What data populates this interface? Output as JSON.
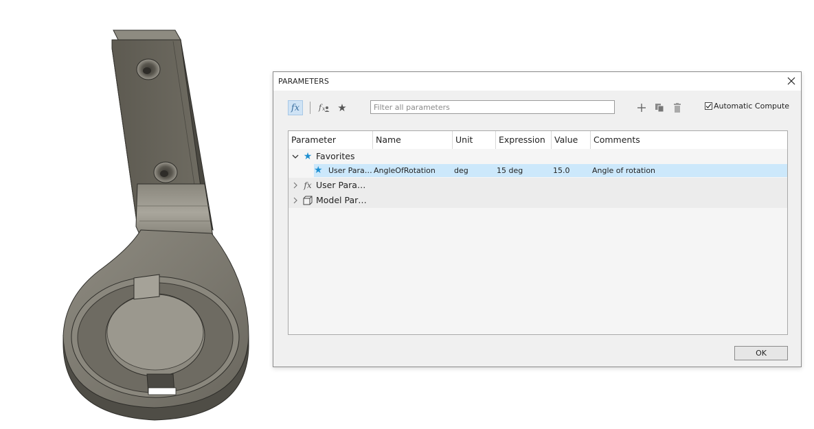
{
  "dialog": {
    "title": "PARAMETERS",
    "toolbar": {
      "filter_placeholder": "Filter all parameters",
      "auto_compute_label": "Automatic Compute",
      "auto_compute_checked": true,
      "icons": [
        "fx-icon",
        "fx-user-icon",
        "star-icon",
        "add-icon",
        "copy-icon",
        "delete-icon"
      ]
    },
    "table": {
      "columns": [
        "Parameter",
        "Name",
        "Unit",
        "Expression",
        "Value",
        "Comments"
      ],
      "groups": {
        "favorites": {
          "label": "Favorites",
          "expanded": true,
          "rows": [
            {
              "parameter": "User Para…",
              "name": "AngleOfRotation",
              "unit": "deg",
              "expression": "15 deg",
              "value": "15.0",
              "comment": "Angle of rotation"
            }
          ]
        },
        "user": {
          "label": "User Para…",
          "expanded": false
        },
        "model": {
          "label": "Model Par…",
          "expanded": false
        }
      }
    },
    "ok_label": "OK"
  },
  "colors": {
    "accent_star": "#1e8fd0",
    "selection": "#cce8fb",
    "active_tool": "#cfe3f5",
    "model_body": "#6d6a60"
  }
}
